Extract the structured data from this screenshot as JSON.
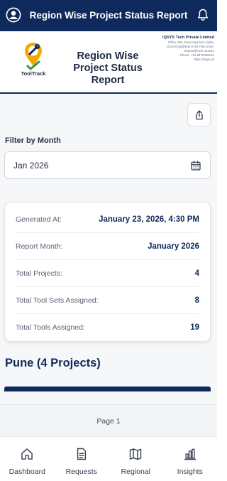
{
  "appbar": {
    "title": "Region Wise Project Status Report",
    "left_icon": "user-circle-icon",
    "right_icon": "bell-icon"
  },
  "report_header": {
    "logo_text": "ToolTrack",
    "title": "Region Wise Project Status Report",
    "company": {
      "name": "iQSYS Tech Private Limited",
      "address_1": "Office 409, Gera Imperium Alpha,",
      "address_2": "Grant Road(Near EON Free Zone,",
      "address_3": "Kharadi)Pune 411014",
      "phone": "Phone: +91 9970486101",
      "website": "https://iqsys.ai/"
    }
  },
  "filter": {
    "label": "Filter by Month",
    "value": "Jan 2026",
    "share_icon": "share-icon",
    "calendar_icon": "calendar-icon"
  },
  "summary": [
    {
      "label": "Generated At:",
      "value": "January 23, 2026, 4:30 PM"
    },
    {
      "label": "Report Month:",
      "value": "January 2026"
    },
    {
      "label": "Total Projects:",
      "value": "4"
    },
    {
      "label": "Total Tool Sets Assigned:",
      "value": "8"
    },
    {
      "label": "Total Tools Assigned:",
      "value": "19"
    }
  ],
  "region": {
    "title": "Pune (4 Projects)"
  },
  "pager": {
    "label": "Page 1"
  },
  "nav": [
    {
      "label": "Dashboard",
      "icon": "home-icon"
    },
    {
      "label": "Requests",
      "icon": "document-icon"
    },
    {
      "label": "Regional",
      "icon": "map-icon"
    },
    {
      "label": "Insights",
      "icon": "bar-chart-icon"
    }
  ],
  "colors": {
    "primary": "#0e2a5c",
    "accent": "#f2a900",
    "background": "#f6f7f9"
  }
}
